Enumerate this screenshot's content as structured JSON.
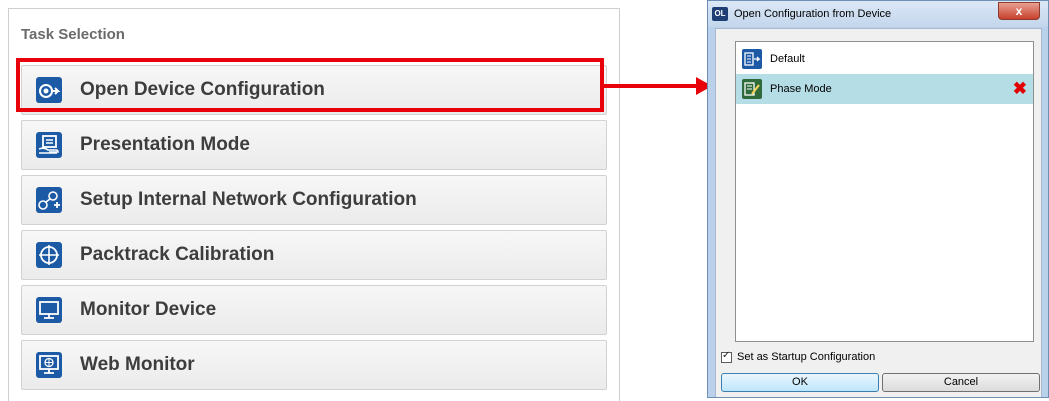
{
  "task_selection": {
    "title": "Task Selection",
    "buttons": [
      {
        "label": "Open Device Configuration",
        "icon": "open-device-icon"
      },
      {
        "label": "Presentation Mode",
        "icon": "presentation-icon"
      },
      {
        "label": "Setup Internal Network Configuration",
        "icon": "network-icon"
      },
      {
        "label": "Packtrack Calibration",
        "icon": "crosshair-icon"
      },
      {
        "label": "Monitor Device",
        "icon": "monitor-icon"
      },
      {
        "label": "Web Monitor",
        "icon": "web-monitor-icon"
      }
    ],
    "highlighted": "Open Device Configuration"
  },
  "dialog": {
    "logo": "OL",
    "title": "Open Configuration from Device",
    "close_label": "x",
    "configurations": [
      {
        "name": "Default",
        "icon": "config-icon",
        "selected": false
      },
      {
        "name": "Phase Mode",
        "icon": "config-edit-icon",
        "selected": true
      }
    ],
    "delete_icon": "✖",
    "startup_checkbox": {
      "label": "Set as Startup Configuration",
      "checked": true
    },
    "ok_label": "OK",
    "cancel_label": "Cancel"
  },
  "colors": {
    "highlight": "#e8000b",
    "selected_row": "#b5dde5",
    "icon_blue": "#1c5aa6"
  }
}
